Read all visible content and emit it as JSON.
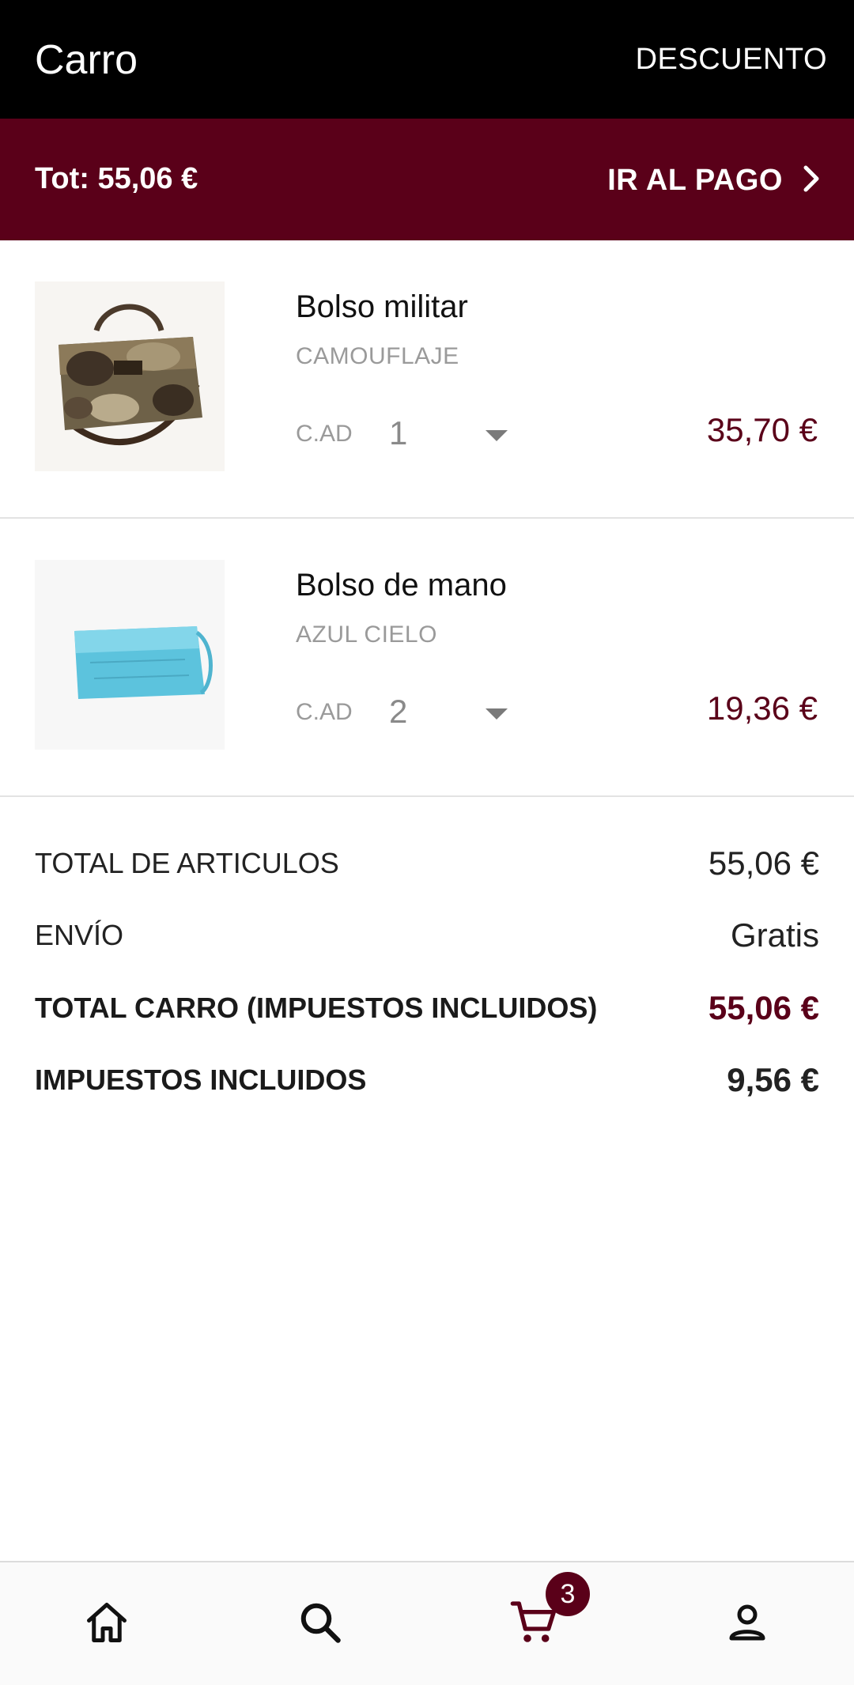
{
  "app_bar": {
    "title": "Carro",
    "discount_label": "DESCUENTO"
  },
  "checkout_bar": {
    "total_label": "Tot: 55,06 €",
    "checkout_label": "IR AL PAGO"
  },
  "items": [
    {
      "name": "Bolso militar",
      "variant": "CAMOUFLAJE",
      "qty_label": "C.AD",
      "qty": "1",
      "price": "35,70 €",
      "image": "camouflage-bag"
    },
    {
      "name": "Bolso de mano",
      "variant": "AZUL CIELO",
      "qty_label": "C.AD",
      "qty": "2",
      "price": "19,36 €",
      "image": "sky-blue-clutch"
    }
  ],
  "summary": {
    "items_total_label": "TOTAL DE ARTICULOS",
    "items_total_value": "55,06 €",
    "shipping_label": "ENVÍO",
    "shipping_value": "Gratis",
    "cart_total_label": "TOTAL CARRO (IMPUESTOS INCLUIDOS)",
    "cart_total_value": "55,06 €",
    "taxes_label": "IMPUESTOS INCLUIDOS",
    "taxes_value": "9,56 €"
  },
  "bottom_nav": {
    "items": [
      {
        "icon": "home-icon"
      },
      {
        "icon": "search-icon"
      },
      {
        "icon": "cart-icon",
        "badge": "3"
      },
      {
        "icon": "account-icon"
      }
    ]
  },
  "colors": {
    "app_bar": "#000000",
    "accent": "#5a0019",
    "price": "#5a0019",
    "nav_background": "#fafafa"
  }
}
